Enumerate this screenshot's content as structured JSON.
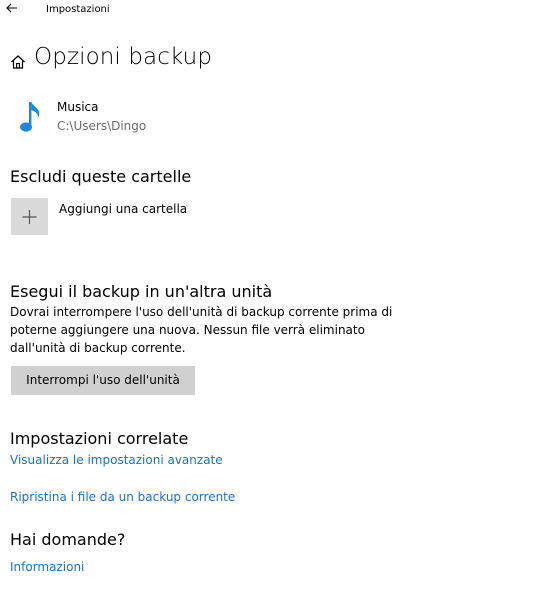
{
  "window": {
    "title": "Impostazioni"
  },
  "header": {
    "title": "Opzioni backup"
  },
  "included_folder": {
    "name": "Musica",
    "path": "C:\\Users\\Dingo"
  },
  "exclude_section": {
    "heading": "Escludi queste cartelle",
    "add_label": "Aggiungi una cartella"
  },
  "other_drive_section": {
    "heading": "Esegui il backup in un'altra unità",
    "description_lines": [
      "Dovrai interrompere l'uso dell'unità di backup corrente prima di",
      "poterne aggiungere una nuova. Nessun file verrà eliminato",
      "dall'unità di backup corrente."
    ],
    "button_label": "Interrompi l'uso dell'unità"
  },
  "related_settings": {
    "heading": "Impostazioni correlate",
    "advanced_link": "Visualizza le impostazioni avanzate",
    "restore_link": "Ripristina i file da un backup corrente"
  },
  "questions": {
    "heading": "Hai domande?",
    "info_link": "Informazioni"
  },
  "icons": {
    "back": "arrow-left-icon",
    "home": "home-icon",
    "music": "music-note-icon",
    "add": "plus-icon"
  },
  "colors": {
    "accent": "#1a73c4",
    "music_icon": "#1e88d8",
    "secondary_text": "#6b6b6b",
    "tile_background": "#dadada",
    "button_background": "#d0d0d0"
  }
}
